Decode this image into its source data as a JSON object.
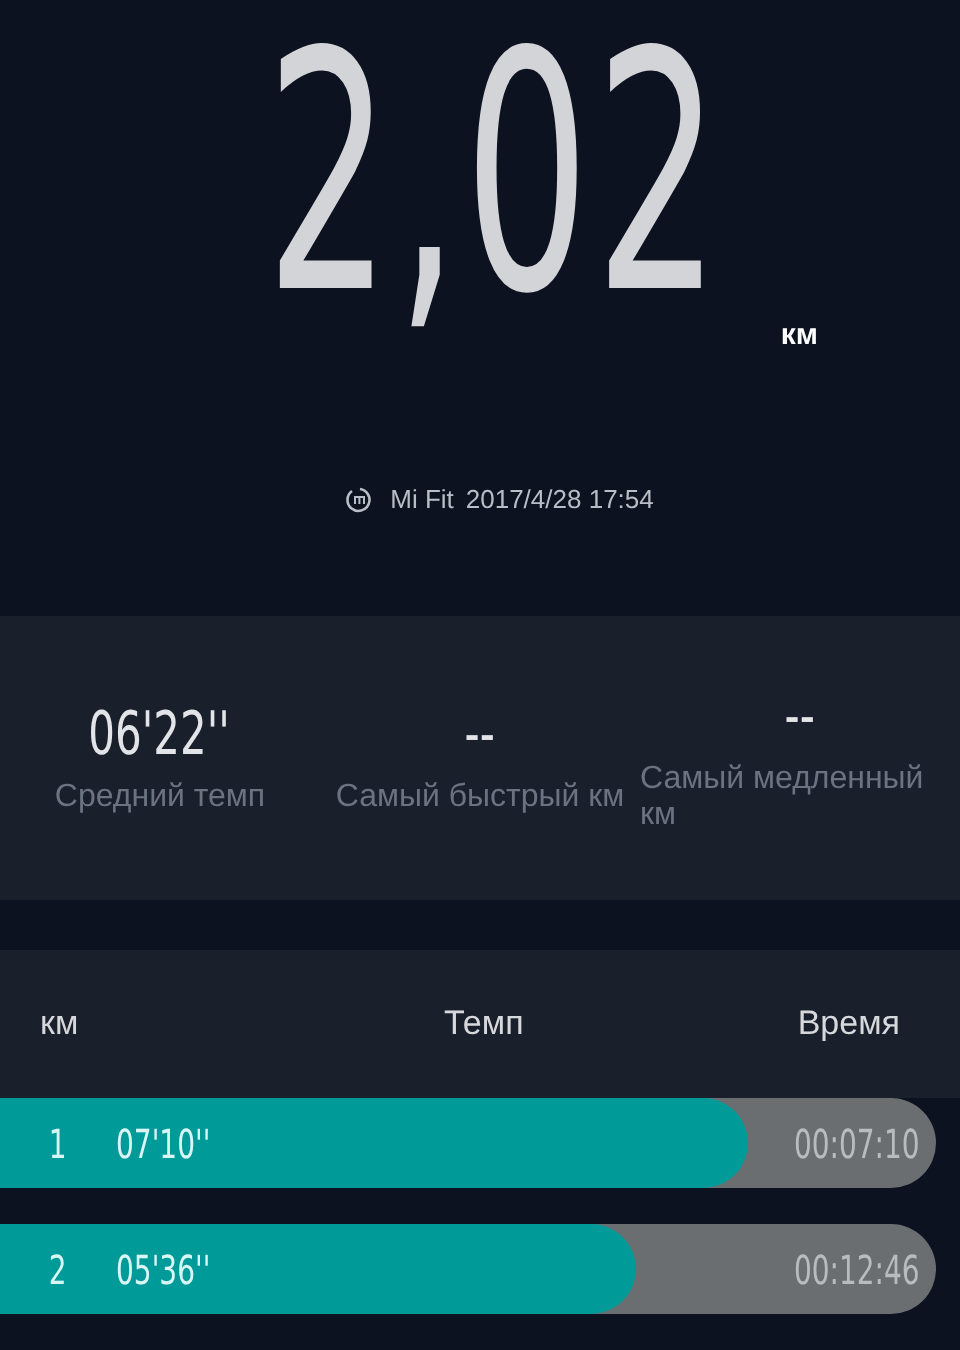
{
  "distance": {
    "value": "2,02",
    "unit": "км"
  },
  "source": {
    "app": "Mi Fit",
    "datetime": "2017/4/28 17:54"
  },
  "stats": [
    {
      "value": "06'22''",
      "label": "Средний темп"
    },
    {
      "value": "--",
      "label": "Самый быстрый км"
    },
    {
      "value": "--",
      "label": "Самый медленный км"
    }
  ],
  "table": {
    "columns": [
      "км",
      "Темп",
      "Время"
    ],
    "rows": [
      {
        "km": "1",
        "pace": "07'10''",
        "time": "00:07:10",
        "level": 0.8
      },
      {
        "km": "2",
        "pace": "05'36''",
        "time": "00:12:46",
        "level": 0.68
      }
    ]
  }
}
